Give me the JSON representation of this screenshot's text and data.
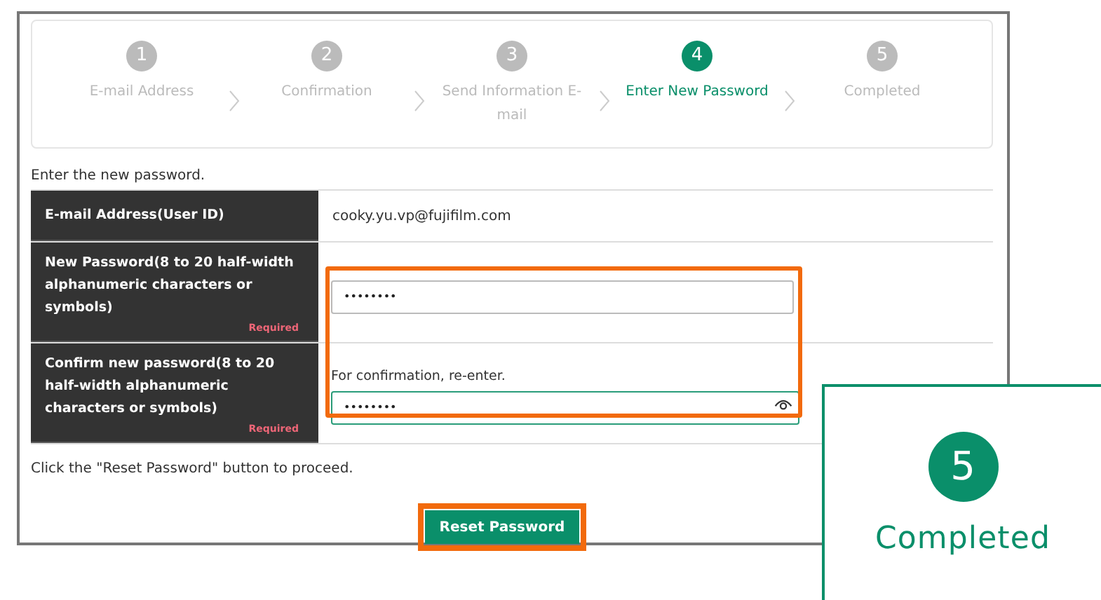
{
  "steps": [
    {
      "number": "1",
      "label": "E-mail Address",
      "selected": false
    },
    {
      "number": "2",
      "label": "Confirmation",
      "selected": false
    },
    {
      "number": "3",
      "label": "Send Information E-mail",
      "selected": false
    },
    {
      "number": "4",
      "label": "Enter New Password",
      "selected": true
    },
    {
      "number": "5",
      "label": "Completed",
      "selected": false
    }
  ],
  "intro": "Enter the new password.",
  "form": {
    "rows": [
      {
        "kind": "text",
        "label": "E-mail Address(User ID)",
        "value": "cooky.yu.vp@fujifilm.com"
      },
      {
        "kind": "password",
        "label": "New Password(8 to 20 half-width alphanumeric characters or symbols)",
        "required": "Required",
        "value": "••••••••",
        "focused": false
      },
      {
        "kind": "password",
        "label": "Confirm new password(8 to 20 half-width alphanumeric characters or symbols)",
        "required": "Required",
        "hint": "For confirmation, re-enter.",
        "value": "••••••••",
        "focused": true
      }
    ]
  },
  "note": "Click the \"Reset Password\" button to proceed.",
  "button": "Reset Password",
  "callout": {
    "number": "5",
    "label": "Completed"
  }
}
